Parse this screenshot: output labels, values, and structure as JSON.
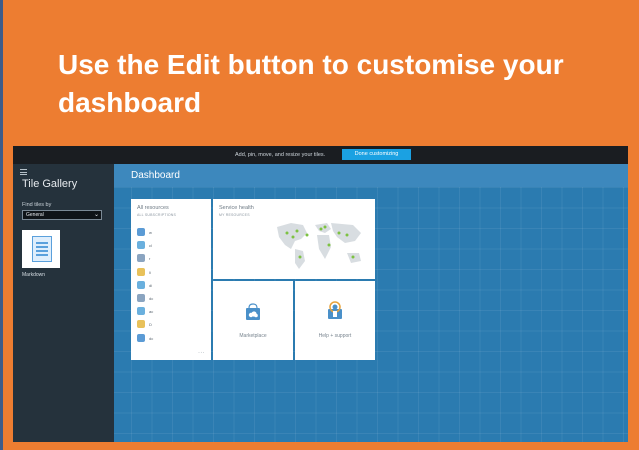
{
  "slide": {
    "title": "Use the Edit button to customise your dashboard"
  },
  "portal": {
    "topbar": {
      "message": "Add, pin, move, and resize your tiles.",
      "done_button": "Done customizing"
    },
    "gallery": {
      "title": "Tile Gallery",
      "find_label": "Find tiles by",
      "filter_value": "General",
      "tile_label": "Markdown"
    },
    "dashboard": {
      "title": "Dashboard",
      "all_resources": {
        "title": "All resources",
        "subtitle": "ALL SUBSCRIPTIONS",
        "rows": [
          {
            "label": "w",
            "icon": "vm-icon",
            "color": "#5b9bd5"
          },
          {
            "label": "cl",
            "icon": "globe-icon",
            "color": "#6ab0de"
          },
          {
            "label": "r",
            "icon": "user-icon",
            "color": "#8aa4c0"
          },
          {
            "label": "li",
            "icon": "storage-icon",
            "color": "#e8c15a"
          },
          {
            "label": "di",
            "icon": "globe-icon",
            "color": "#6ab0de"
          },
          {
            "label": "dc",
            "icon": "user-icon",
            "color": "#8aa4c0"
          },
          {
            "label": "ac",
            "icon": "globe-icon",
            "color": "#6ab0de"
          },
          {
            "label": "D",
            "icon": "user-icon",
            "color": "#e8c15a"
          },
          {
            "label": "dc",
            "icon": "database-icon",
            "color": "#5b9bd5"
          }
        ],
        "more": "···"
      },
      "service_health": {
        "title": "Service health",
        "subtitle": "MY RESOURCES"
      },
      "marketplace": {
        "label": "Marketplace"
      },
      "help": {
        "label": "Help + support"
      }
    }
  },
  "colors": {
    "slide_bg": "#ED7D31",
    "accent": "#1ba1e2",
    "dashboard_bg": "#2b7bb0",
    "health_green": "#7dc242"
  }
}
